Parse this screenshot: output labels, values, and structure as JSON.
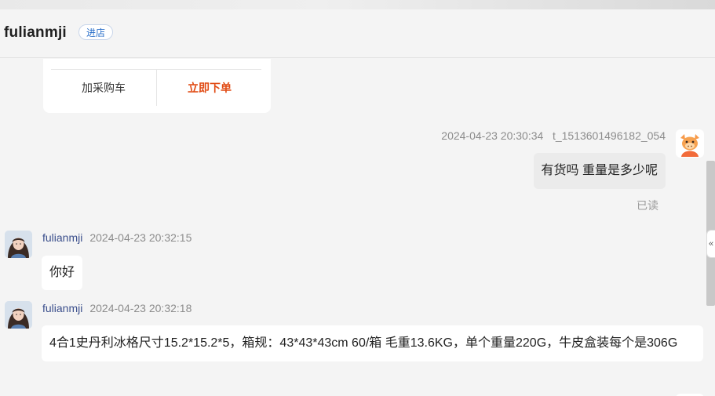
{
  "header": {
    "shop_name": "fulianmji",
    "enter_shop_label": "进店"
  },
  "product_card": {
    "add_cart_label": "加采购车",
    "order_now_label": "立即下单"
  },
  "messages": [
    {
      "sender": "t_1513601496182_054",
      "time": "2024-04-23 20:30:34",
      "text": "有货吗 重量是多少呢",
      "status": "已读",
      "side": "right"
    },
    {
      "sender": "fulianmji",
      "time": "2024-04-23 20:32:15",
      "text": "你好",
      "side": "left"
    },
    {
      "sender": "fulianmji",
      "time": "2024-04-23 20:32:18",
      "text": "4合1史丹利冰格尺寸15.2*15.2*5，箱规：43*43*43cm  60/箱  毛重13.6KG，单个重量220G，牛皮盒装每个是306G",
      "side": "left"
    }
  ],
  "icons": {
    "enter_shop": "store-badge",
    "self_avatar": "cartoon-avatar-icon",
    "peer_avatar": "profile-photo",
    "collapse": "double-chevron-left-icon"
  },
  "colors": {
    "accent_blue": "#2a6fc9",
    "order_red": "#e14b14",
    "nick_blue": "#3b4f8c",
    "bg": "#f4f4f4"
  }
}
